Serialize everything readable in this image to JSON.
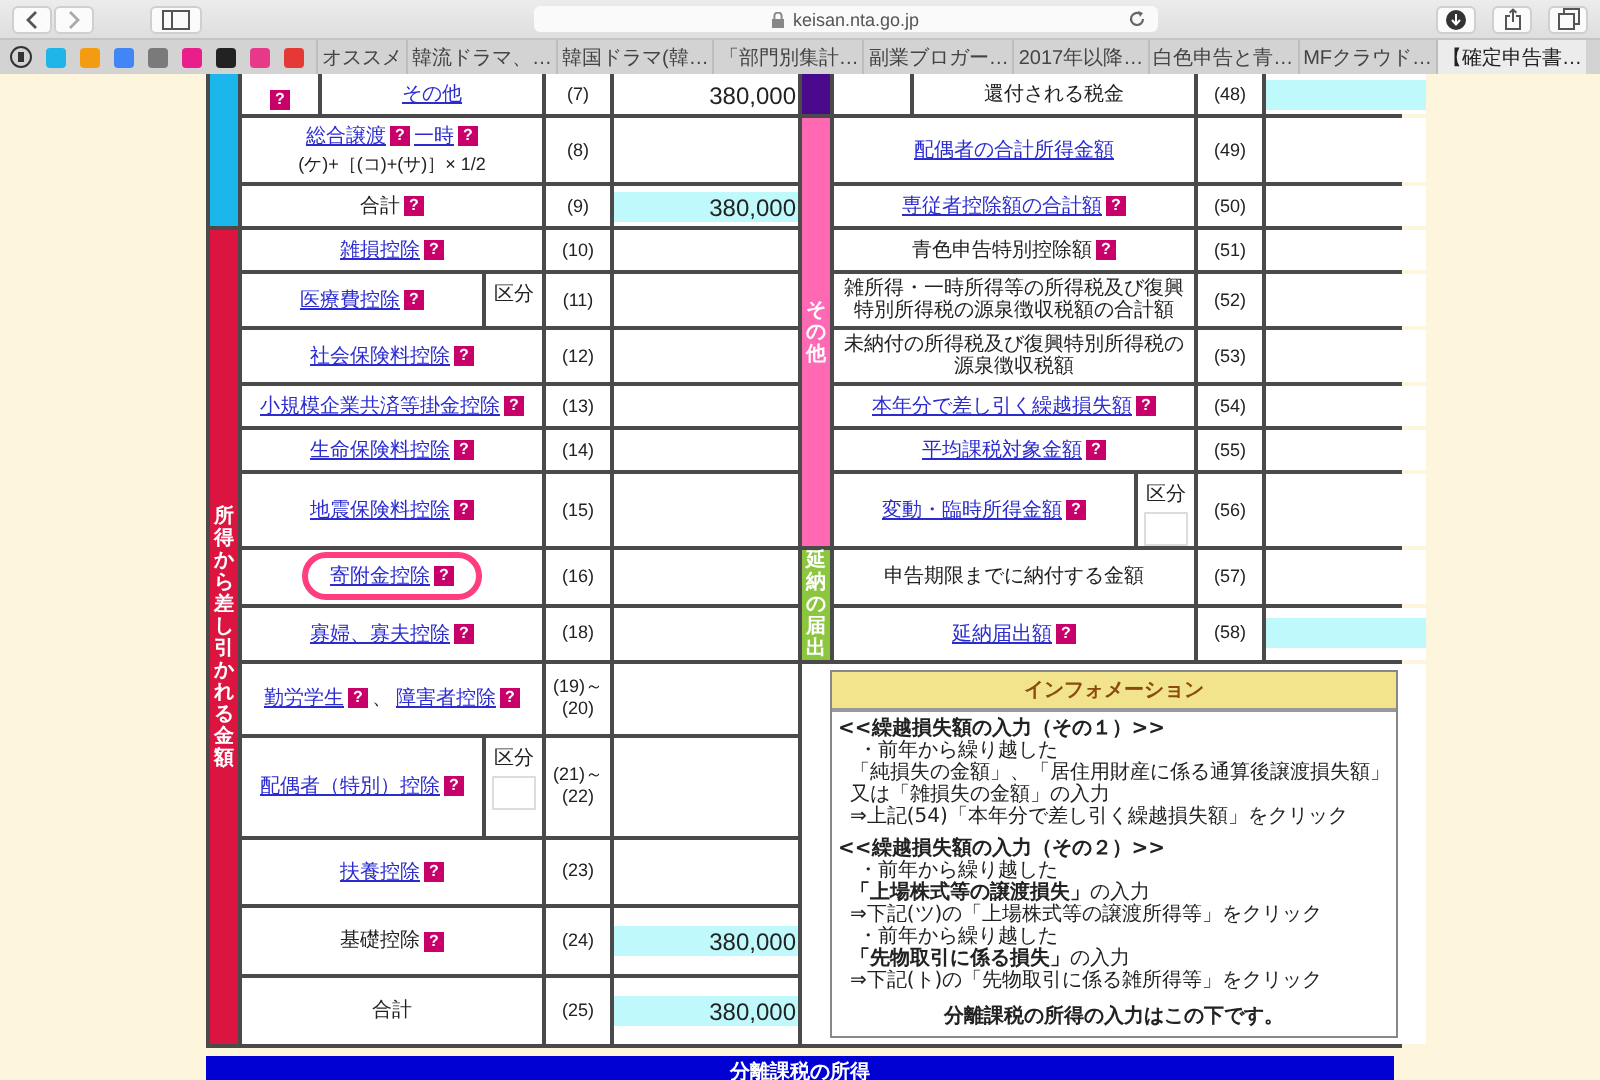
{
  "browser": {
    "url": "keisan.nta.go.jp",
    "tabs": [
      {
        "title": "オススメ",
        "selected": false
      },
      {
        "title": "韓流ドラマ、…",
        "selected": false
      },
      {
        "title": "韓国ドラマ(韓…",
        "selected": false
      },
      {
        "title": "「部門別集計…",
        "selected": false
      },
      {
        "title": "副業ブロガー…",
        "selected": false
      },
      {
        "title": "2017年以降…",
        "selected": false
      },
      {
        "title": "白色申告と青…",
        "selected": false
      },
      {
        "title": "MFクラウド…",
        "selected": false
      },
      {
        "title": "【確定申告書…",
        "selected": true
      }
    ]
  },
  "form": {
    "left": [
      {
        "color": "#1ab6ec",
        "rows": [
          {
            "split": true,
            "lead_help": "?",
            "parts": [
              {
                "text": "その他",
                "link": true
              }
            ],
            "number": "(7)",
            "value": "380,000",
            "highlighted": false,
            "circled": false
          },
          {
            "split": false,
            "parts": [
              {
                "text": "総合譲渡",
                "link": true,
                "help": "?"
              },
              {
                "text": "一時",
                "link": true,
                "help": "?"
              }
            ],
            "note": "(ケ)+［(コ)+(サ)］× 1/2",
            "number": "(8)",
            "highlighted": false,
            "circled": false
          },
          {
            "split": false,
            "parts": [
              {
                "text": "合計",
                "link": false,
                "help": "?"
              }
            ],
            "number": "(9)",
            "value": "380,000",
            "highlighted": true,
            "circled": false
          }
        ]
      },
      {
        "color": "#dc1440",
        "label": "所得から差し引かれる金額",
        "rows": [
          {
            "split": false,
            "parts": [
              {
                "text": "雑損控除",
                "link": true,
                "help": "?"
              }
            ],
            "number": "(10)",
            "highlighted": false,
            "circled": false
          },
          {
            "split": false,
            "parts": [
              {
                "text": "医療費控除",
                "link": true,
                "help": "?"
              }
            ],
            "side": {
              "label": "区分",
              "box": false
            },
            "number": "(11)",
            "highlighted": false,
            "circled": false
          },
          {
            "split": false,
            "parts": [
              {
                "text": "社会保険料控除",
                "link": true,
                "help": "?"
              }
            ],
            "number": "(12)",
            "highlighted": false,
            "circled": false
          },
          {
            "split": false,
            "parts": [
              {
                "text": "小規模企業共済等掛金控除",
                "link": true,
                "help": "?"
              }
            ],
            "number": "(13)",
            "highlighted": false,
            "circled": false
          },
          {
            "split": false,
            "parts": [
              {
                "text": "生命保険料控除",
                "link": true,
                "help": "?"
              }
            ],
            "number": "(14)",
            "highlighted": false,
            "circled": false
          },
          {
            "split": false,
            "parts": [
              {
                "text": "地震保険料控除",
                "link": true,
                "help": "?"
              }
            ],
            "number": "(15)",
            "highlighted": false,
            "circled": false
          },
          {
            "split": false,
            "parts": [
              {
                "text": "寄附金控除",
                "link": true,
                "help": "?"
              }
            ],
            "number": "(16)",
            "highlighted": false,
            "circled": true
          },
          {
            "split": false,
            "parts": [
              {
                "text": "寡婦、寡夫控除",
                "link": true,
                "help": "?"
              }
            ],
            "number": "(18)",
            "highlighted": false,
            "circled": false
          },
          {
            "split": false,
            "parts": [
              {
                "text": "勤労学生",
                "link": true,
                "help": "?",
                "sep": "、"
              },
              {
                "text": "障害者控除",
                "link": true,
                "help": "?"
              }
            ],
            "number": "(19)～\n(20)",
            "highlighted": false,
            "circled": false
          },
          {
            "split": false,
            "parts": [
              {
                "text": "配偶者（特別）控除",
                "link": true,
                "help": "?"
              }
            ],
            "side": {
              "label": "区分",
              "box": true
            },
            "number": "(21)～\n(22)",
            "highlighted": false,
            "circled": false
          },
          {
            "split": false,
            "parts": [
              {
                "text": "扶養控除",
                "link": true,
                "help": "?"
              }
            ],
            "number": "(23)",
            "highlighted": false,
            "circled": false
          },
          {
            "split": false,
            "parts": [
              {
                "text": "基礎控除",
                "link": false,
                "help": "?"
              }
            ],
            "number": "(24)",
            "value": "380,000",
            "highlighted": true,
            "circled": false
          },
          {
            "split": false,
            "parts": [
              {
                "text": "合計",
                "link": false
              }
            ],
            "number": "(25)",
            "value": "380,000",
            "highlighted": true,
            "circled": false
          }
        ]
      }
    ],
    "right": [
      {
        "color": "#4b0a8c",
        "rows": [
          {
            "split": true,
            "parts": [
              {
                "text": "還付される税金",
                "link": false
              }
            ],
            "number": "(48)",
            "highlighted": true,
            "circled": false
          }
        ]
      },
      {
        "color": "#ff69b4",
        "label": "その他",
        "rows": [
          {
            "split": false,
            "parts": [
              {
                "text": "配偶者の合計所得金額",
                "link": true
              }
            ],
            "number": "(49)",
            "highlighted": false,
            "circled": false
          },
          {
            "split": false,
            "parts": [
              {
                "text": "専従者控除額の合計額",
                "link": true,
                "help": "?"
              }
            ],
            "number": "(50)",
            "highlighted": false,
            "circled": false
          },
          {
            "split": false,
            "parts": [
              {
                "text": "青色申告特別控除額",
                "link": false,
                "help": "?"
              }
            ],
            "number": "(51)",
            "highlighted": false,
            "circled": false
          },
          {
            "split": false,
            "parts": [
              {
                "text": "雑所得・一時所得等の所得税及び復興特別所得税の源泉徴収税額の合計額",
                "link": false
              }
            ],
            "number": "(52)",
            "highlighted": false,
            "circled": false
          },
          {
            "split": false,
            "parts": [
              {
                "text": "未納付の所得税及び復興特別所得税の源泉徴収税額",
                "link": false
              }
            ],
            "number": "(53)",
            "highlighted": false,
            "circled": false
          },
          {
            "split": false,
            "parts": [
              {
                "text": "本年分で差し引く繰越損失額",
                "link": true,
                "help": "?"
              }
            ],
            "number": "(54)",
            "highlighted": false,
            "circled": false
          },
          {
            "split": false,
            "parts": [
              {
                "text": "平均課税対象金額",
                "link": true,
                "help": "?"
              }
            ],
            "number": "(55)",
            "highlighted": false,
            "circled": false
          },
          {
            "split": false,
            "parts": [
              {
                "text": "変動・臨時所得金額",
                "link": true,
                "help": "?"
              }
            ],
            "side": {
              "label": "区分",
              "box": true
            },
            "number": "(56)",
            "highlighted": false,
            "circled": false
          }
        ]
      },
      {
        "color": "#8cc63e",
        "label": "延納の届出",
        "rows": [
          {
            "split": false,
            "parts": [
              {
                "text": "申告期限までに納付する金額",
                "link": false
              }
            ],
            "number": "(57)",
            "highlighted": false,
            "circled": false
          },
          {
            "split": false,
            "parts": [
              {
                "text": "延納届出額",
                "link": true,
                "help": "?"
              }
            ],
            "number": "(58)",
            "highlighted": true,
            "circled": false
          }
        ]
      }
    ],
    "info": {
      "title": "インフォメーション",
      "blocks": [
        {
          "heading": "<<繰越損失額の入力（その１）>>",
          "lines": [
            {
              "kind": "bullet",
              "text": "・前年から繰り越した"
            },
            {
              "kind": "text",
              "text": "「純損失の金額」、「居住用財産に係る通算後譲渡損失額」又は「雑損失の金額」の入力"
            },
            {
              "kind": "text",
              "text": "⇒上記(54)「本年分で差し引く繰越損失額」をクリック"
            }
          ]
        },
        {
          "heading": "<<繰越損失額の入力（その２）>>",
          "lines": [
            {
              "kind": "bullet",
              "text": "・前年から繰り越した"
            },
            {
              "kind": "text",
              "text": "**「上場株式等の譲渡損失」**の入力"
            },
            {
              "kind": "text",
              "text": "⇒下記(ツ)の「上場株式等の譲渡所得等」をクリック"
            },
            {
              "kind": "bullet",
              "text": "・前年から繰り越した"
            },
            {
              "kind": "text",
              "text": "**「先物取引に係る損失」**の入力"
            },
            {
              "kind": "text",
              "text": "⇒下記(ト)の「先物取引に係る雑所得等」をクリック"
            }
          ]
        }
      ],
      "footer": "分離課税の所得の入力はこの下です。"
    }
  },
  "next_section": {
    "title": "分離課税の所得"
  }
}
